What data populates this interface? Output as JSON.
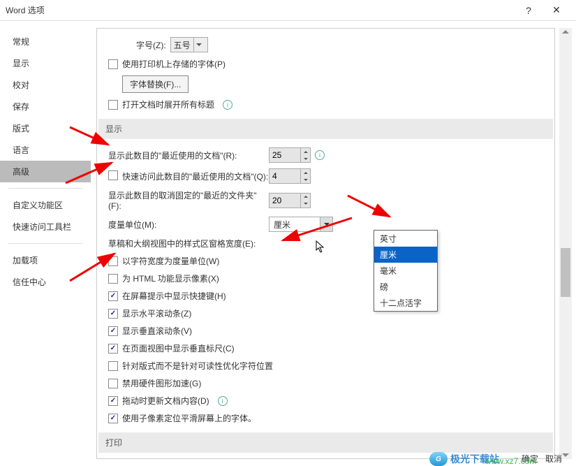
{
  "title": "Word 选项",
  "nav": [
    "常规",
    "显示",
    "校对",
    "保存",
    "版式",
    "语言",
    "高级",
    "自定义功能区",
    "快速访问工具栏",
    "加载项",
    "信任中心"
  ],
  "nav_selected": 6,
  "top": {
    "font_size_label": "字号(Z):",
    "font_size_value": "五号",
    "use_printer_fonts": "使用打印机上存储的字体(P)",
    "font_substitute_btn": "字体替换(F)...",
    "expand_headings": "打开文档时展开所有标题"
  },
  "section_display": "显示",
  "display_rows": {
    "recent_docs_label": "显示此数目的\"最近使用的文档\"(R):",
    "recent_docs_value": "25",
    "quick_access_label": "快速访问此数目的\"最近使用的文档\"(Q):",
    "quick_access_value": "4",
    "unpinned_label": "显示此数目的取消固定的\"最近的文件夹\"(F):",
    "unpinned_value": "20",
    "measure_label": "度量单位(M):",
    "measure_value": "厘米",
    "draft_width_label": "草稿和大纲视图中的样式区窗格宽度(E):"
  },
  "unit_options": [
    "英寸",
    "厘米",
    "毫米",
    "磅",
    "十二点活字"
  ],
  "unit_selected": 1,
  "checks": [
    {
      "label": "以字符宽度为度量单位(W)",
      "checked": false
    },
    {
      "label": "为 HTML 功能显示像素(X)",
      "checked": false
    },
    {
      "label": "在屏幕提示中显示快捷键(H)",
      "checked": true
    },
    {
      "label": "显示水平滚动条(Z)",
      "checked": true
    },
    {
      "label": "显示垂直滚动条(V)",
      "checked": true
    },
    {
      "label": "在页面视图中显示垂直标尺(C)",
      "checked": true
    },
    {
      "label": "针对版式而不是针对可读性优化字符位置",
      "checked": false
    },
    {
      "label": "禁用硬件图形加速(G)",
      "checked": false
    },
    {
      "label": "拖动时更新文档内容(D)",
      "checked": true
    },
    {
      "label": "使用子像素定位平滑屏幕上的字体。",
      "checked": true
    }
  ],
  "section_print": "打印",
  "buttons": {
    "ok": "确定",
    "cancel": "取消"
  },
  "watermark": {
    "brand": "极光下载站",
    "url": "www.xz7.com"
  }
}
